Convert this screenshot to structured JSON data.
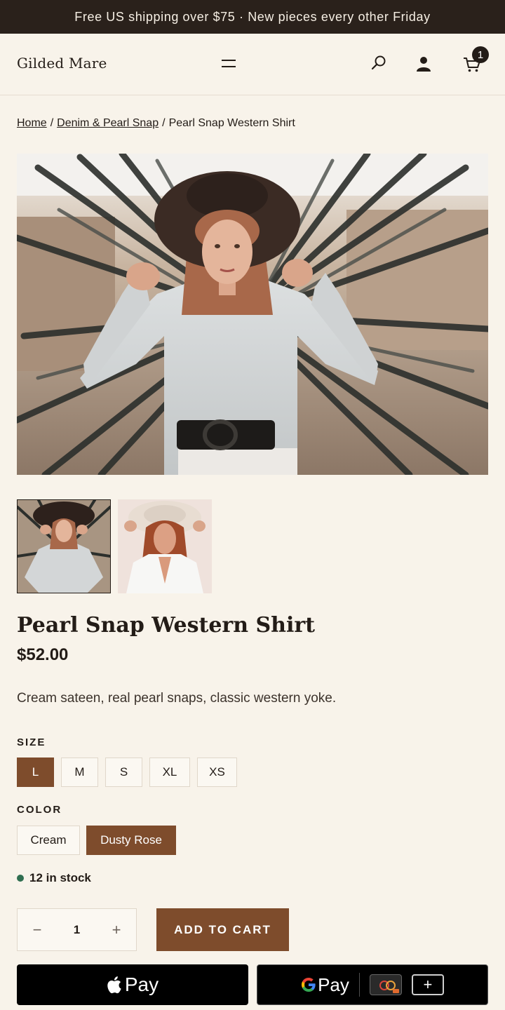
{
  "announcement": "Free US shipping over $75 · New pieces every other Friday",
  "header": {
    "logo": "Gilded Mare",
    "cart_count": "1"
  },
  "breadcrumb": {
    "home": "Home",
    "separator": "/",
    "category": "Denim & Pearl Snap",
    "current": "Pearl Snap Western Shirt"
  },
  "product": {
    "title": "Pearl Snap Western Shirt",
    "price": "$52.00",
    "description": "Cream sateen, real pearl snaps, classic western yoke.",
    "images": [
      "woman in light denim shirt and dark wide-brim hat among palm fronds",
      "woman in white shirt and cream wide-brim hat"
    ]
  },
  "options": {
    "size_label": "SIZE",
    "sizes": [
      "L",
      "M",
      "S",
      "XL",
      "XS"
    ],
    "selected_size": "L",
    "color_label": "COLOR",
    "colors": [
      "Cream",
      "Dusty Rose"
    ],
    "selected_color": "Dusty Rose"
  },
  "stock": "12 in stock",
  "quantity": {
    "minus": "−",
    "value": "1",
    "plus": "+"
  },
  "buttons": {
    "add_to_cart": "ADD TO CART",
    "apple_pay": "Pay",
    "google_pay": "Pay",
    "add_card": "+"
  },
  "colors": {
    "accent": "#7e4c2c",
    "background": "#f8f3ea",
    "announcement_bg": "#2a211b",
    "stock_dot": "#2f6e50"
  }
}
